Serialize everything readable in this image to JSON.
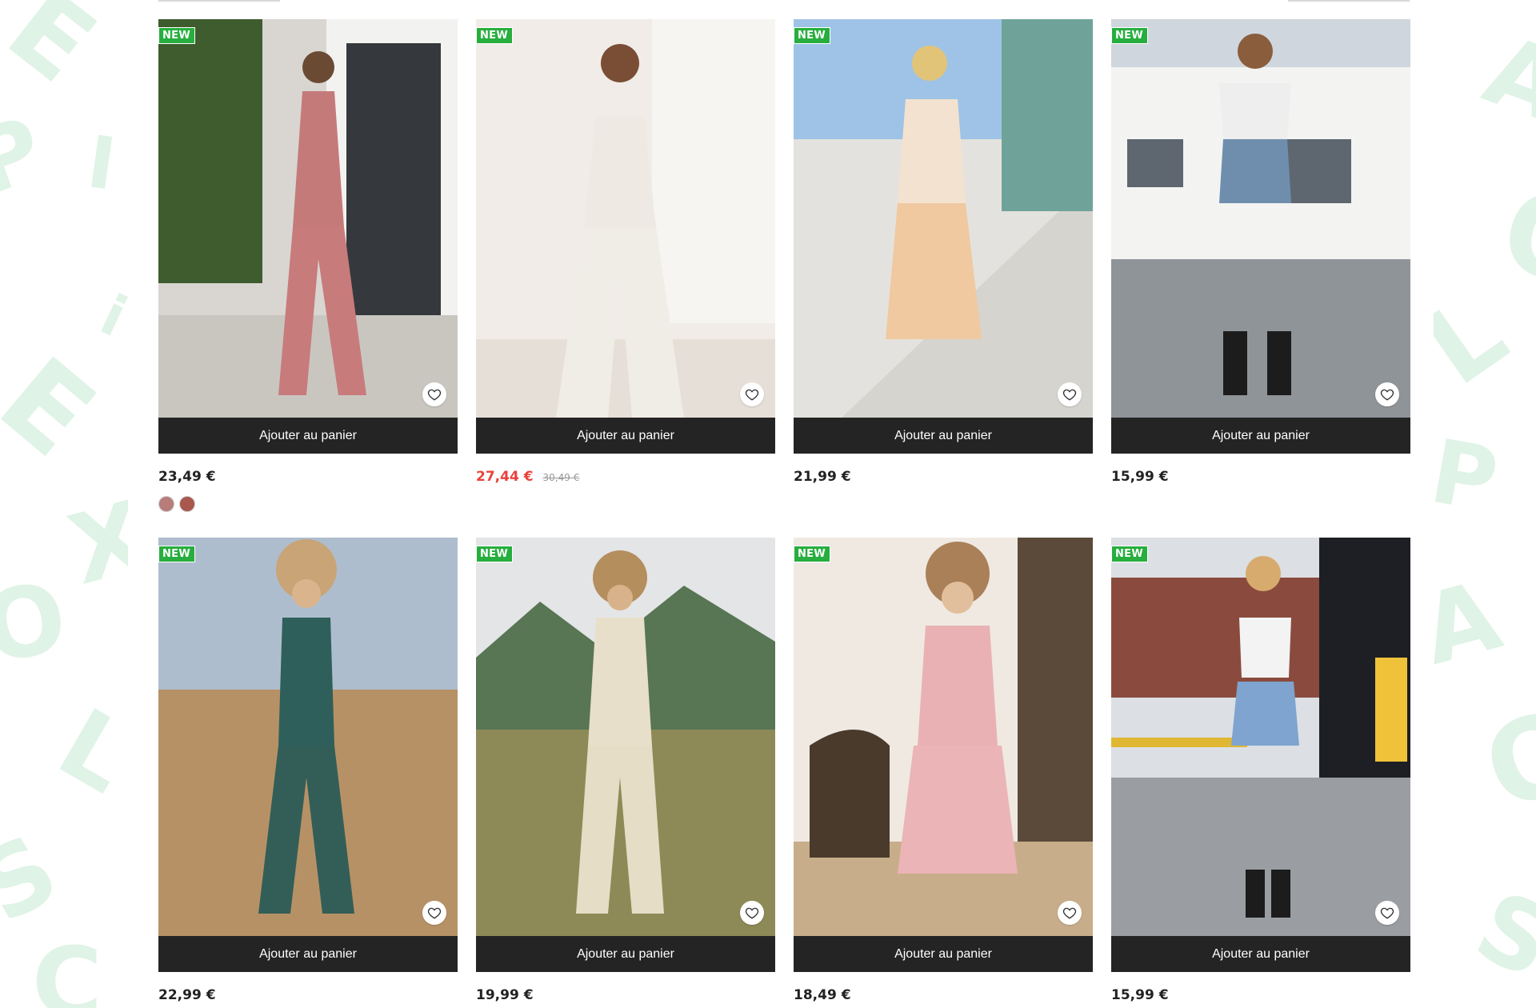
{
  "products": [
    {
      "badge": "NEW",
      "add_to_cart": "Ajouter au panier",
      "price": "23,49 €",
      "old_price": "",
      "on_sale": false,
      "swatches": [
        "#b77d7a",
        "#a8584c"
      ],
      "image_label": "Pink wide-leg jumpsuit"
    },
    {
      "badge": "NEW",
      "add_to_cart": "Ajouter au panier",
      "price": "27,44 €",
      "old_price": "30,49 €",
      "on_sale": true,
      "swatches": [],
      "image_label": "White halter jumpsuit"
    },
    {
      "badge": "NEW",
      "add_to_cart": "Ajouter au panier",
      "price": "21,99 €",
      "old_price": "",
      "on_sale": false,
      "swatches": [],
      "image_label": "Orange floral dress"
    },
    {
      "badge": "NEW",
      "add_to_cart": "Ajouter au panier",
      "price": "15,99 €",
      "old_price": "",
      "on_sale": false,
      "swatches": [],
      "image_label": "Cow print crop top"
    },
    {
      "badge": "NEW",
      "add_to_cart": "Ajouter au panier",
      "price": "22,99 €",
      "old_price": "",
      "on_sale": false,
      "swatches": [],
      "image_label": "Geometric print halter jumpsuit"
    },
    {
      "badge": "NEW",
      "add_to_cart": "Ajouter au panier",
      "price": "19,99 €",
      "old_price": "",
      "on_sale": false,
      "swatches": [],
      "image_label": "Beige overall jumpsuit"
    },
    {
      "badge": "NEW",
      "add_to_cart": "Ajouter au panier",
      "price": "18,49 €",
      "old_price": "",
      "on_sale": false,
      "swatches": [],
      "image_label": "Pink wrap dress"
    },
    {
      "badge": "NEW",
      "add_to_cart": "Ajouter au panier",
      "price": "15,99 €",
      "old_price": "",
      "on_sale": false,
      "swatches": [],
      "image_label": "Graphic tee and denim shorts"
    }
  ],
  "colors": {
    "badge": "#27ae3e",
    "button": "#242424",
    "sale": "#e8423b",
    "bg_letters": "#dff3e6"
  }
}
